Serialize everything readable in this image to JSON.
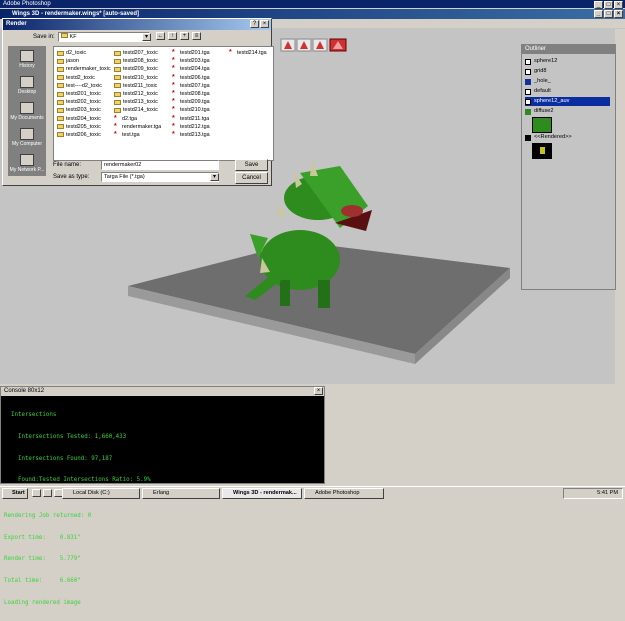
{
  "photoshop": {
    "title": "Adobe Photoshop"
  },
  "wings": {
    "title": "Wings 3D - rendermaker.wings* [auto-saved]"
  },
  "render_dialog": {
    "title": "Render",
    "save_in_label": "Save in:",
    "save_in_value": "KF",
    "places": [
      "History",
      "Desktop",
      "My Documents",
      "My Computer",
      "My Network P..."
    ],
    "columns": [
      [
        {
          "name": "d2_toxic",
          "type": "folder"
        },
        {
          "name": "jason",
          "type": "folder"
        },
        {
          "name": "rendermaker_toxic",
          "type": "folder"
        },
        {
          "name": "testd2_toxic",
          "type": "folder"
        },
        {
          "name": "test----d2_toxic",
          "type": "folder"
        },
        {
          "name": "testd201_toxic",
          "type": "folder"
        },
        {
          "name": "testd202_toxic",
          "type": "folder"
        },
        {
          "name": "testd203_toxic",
          "type": "folder"
        },
        {
          "name": "testd204_toxic",
          "type": "folder"
        },
        {
          "name": "testd205_toxic",
          "type": "folder"
        },
        {
          "name": "testd206_toxic",
          "type": "folder"
        }
      ],
      [
        {
          "name": "testd207_toxic",
          "type": "folder"
        },
        {
          "name": "testd208_toxic",
          "type": "folder"
        },
        {
          "name": "testd209_toxic",
          "type": "folder"
        },
        {
          "name": "testd210_toxic",
          "type": "folder"
        },
        {
          "name": "testd211_toxic",
          "type": "folder"
        },
        {
          "name": "testd212_toxic",
          "type": "folder"
        },
        {
          "name": "testd213_toxic",
          "type": "folder"
        },
        {
          "name": "testd214_toxic",
          "type": "folder"
        },
        {
          "name": "d2.tga",
          "type": "tga"
        },
        {
          "name": "rendermaker.tga",
          "type": "tga"
        },
        {
          "name": "test.tga",
          "type": "tga"
        }
      ],
      [
        {
          "name": "testd201.tga",
          "type": "tga"
        },
        {
          "name": "testd203.tga",
          "type": "tga"
        },
        {
          "name": "testd204.tga",
          "type": "tga"
        },
        {
          "name": "testd206.tga",
          "type": "tga"
        },
        {
          "name": "testd207.tga",
          "type": "tga"
        },
        {
          "name": "testd208.tga",
          "type": "tga"
        },
        {
          "name": "testd209.tga",
          "type": "tga"
        },
        {
          "name": "testd210.tga",
          "type": "tga"
        },
        {
          "name": "testd211.tga",
          "type": "tga"
        },
        {
          "name": "testd212.tga",
          "type": "tga"
        },
        {
          "name": "testd213.tga",
          "type": "tga"
        }
      ],
      [
        {
          "name": "testd214.tga",
          "type": "tga"
        }
      ]
    ],
    "file_name_label": "File name:",
    "file_name_value": "rendermaker02",
    "save_as_type_label": "Save as type:",
    "save_as_type_value": "Targa File (*.tga)",
    "save_button": "Save",
    "cancel_button": "Cancel"
  },
  "outliner": {
    "title": "Outliner",
    "items": [
      {
        "label": "sphere12",
        "icon": "object-icon",
        "selected": false
      },
      {
        "label": "grid8",
        "icon": "object-icon",
        "selected": false
      },
      {
        "label": "_hole_",
        "icon": "material-icon",
        "selected": false
      },
      {
        "label": "default",
        "icon": "material-icon",
        "selected": false
      },
      {
        "label": "sphere12_auv",
        "icon": "material-icon",
        "selected": true
      },
      {
        "label": "diffuse2",
        "icon": "texture-icon",
        "selected": false
      },
      {
        "label": "<<Rendered>>",
        "icon": "render-icon",
        "selected": false
      }
    ]
  },
  "console": {
    "title": "Console 80x12",
    "lines": [
      "  Intersections",
      "    Intersections Tested: 1,660,433",
      "    Intersections Found: 97,187",
      "    Found:Tested Intersections Ratio: 5.9%",
      "",
      "Rendering Job returned: 0",
      "Export time:    0.831\"",
      "Render time:    5.779\"",
      "Total time:     6.660\"",
      "Loading rendered image"
    ]
  },
  "taskbar": {
    "start": "Start",
    "buttons": [
      "Local Disk (C:)",
      "Erlang",
      "Wings 3D - rendermak...",
      "Adobe Photoshop"
    ],
    "clock": "5:41 PM"
  },
  "colors": {
    "title_blue": "#0a246a",
    "console_green": "#3cd23c",
    "model_green": "#2e8b1e",
    "selection_blue": "#0a2ea0"
  }
}
